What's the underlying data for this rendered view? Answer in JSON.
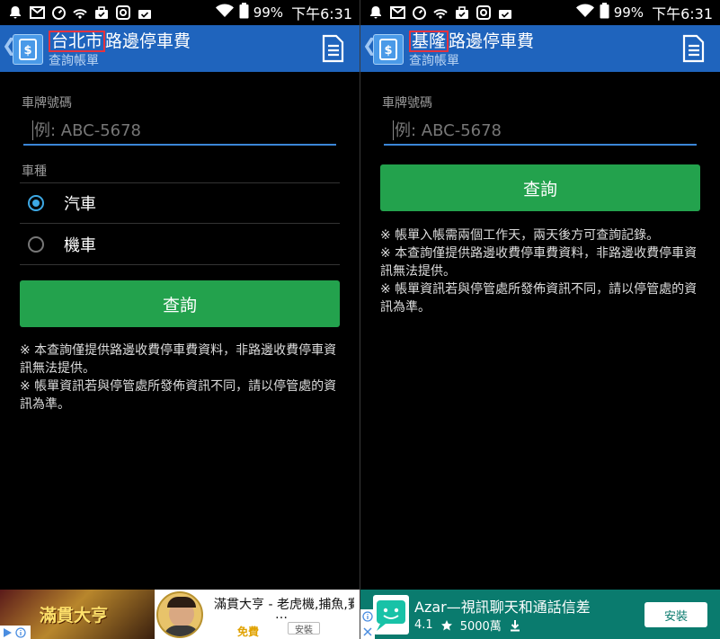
{
  "status_bar": {
    "battery": "99%",
    "time": "下午6:31",
    "icons": [
      "notification-bell-icon",
      "gmail-icon",
      "speed-icon",
      "wifi-icon",
      "briefcase-icon",
      "instagram-icon",
      "shield-check-icon"
    ]
  },
  "left": {
    "title_city": "台北市",
    "title_rest": "路邊停車費",
    "subtitle": "查詢帳單",
    "plate_label": "車牌號碼",
    "plate_placeholder": "例: ABC-5678",
    "vehicle_label": "車種",
    "vehicle_options": [
      {
        "label": "汽車",
        "selected": true
      },
      {
        "label": "機車",
        "selected": false
      }
    ],
    "query_button": "查詢",
    "notes": [
      "※ 本查詢僅提供路邊收費停車費資料，非路邊收費停車資訊無法提供。",
      "※ 帳單資訊若與停管處所發佈資訊不同，請以停管處的資訊為準。"
    ],
    "ad": {
      "game_logo": "滿貫大亨",
      "title": "滿貫大亨 - 老虎機,捕魚,賽",
      "ellipsis": "…",
      "free": "免費",
      "install": "安裝"
    }
  },
  "right": {
    "title_city": "基隆",
    "title_rest": "路邊停車費",
    "subtitle": "查詢帳單",
    "plate_label": "車牌號碼",
    "plate_placeholder": "例: ABC-5678",
    "query_button": "查詢",
    "notes": [
      "※ 帳單入帳需兩個工作天，兩天後方可查詢記錄。",
      "※ 本查詢僅提供路邊收費停車費資料，非路邊收費停車資訊無法提供。",
      "※ 帳單資訊若與停管處所發佈資訊不同，請以停管處的資訊為準。"
    ],
    "ad": {
      "title": "Azar—視訊聊天和通話信差",
      "rating": "4.1",
      "downloads": "5000萬",
      "install": "安裝"
    }
  },
  "colors": {
    "app_bar": "#1f64bd",
    "query_button": "#23a24d",
    "radio_active": "#3da8e4",
    "city_highlight": "#e6323e"
  }
}
